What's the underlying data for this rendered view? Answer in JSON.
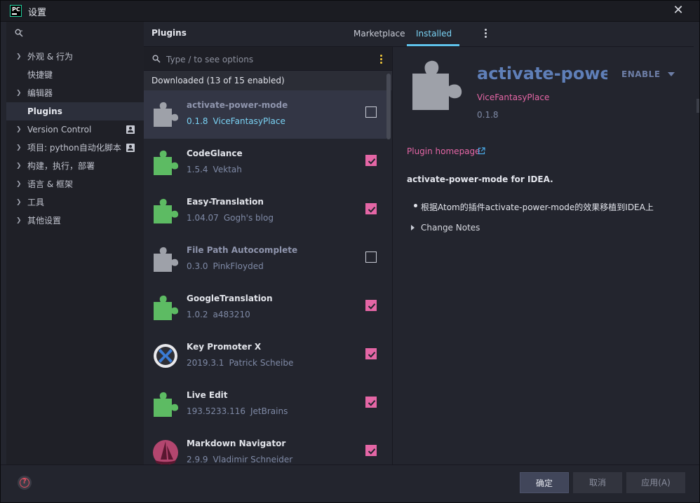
{
  "window": {
    "title": "设置",
    "app_logo": "PC"
  },
  "sidebar": {
    "items": [
      {
        "label": "外观 & 行为",
        "expandable": true
      },
      {
        "label": "快捷键",
        "expandable": false
      },
      {
        "label": "编辑器",
        "expandable": true
      },
      {
        "label": "Plugins",
        "expandable": false,
        "active": true
      },
      {
        "label": "Version Control",
        "expandable": true,
        "badge": "person-icon"
      },
      {
        "label": "项目: python自动化脚本",
        "expandable": true,
        "badge": "person-icon"
      },
      {
        "label": "构建，执行，部署",
        "expandable": true
      },
      {
        "label": "语言 & 框架",
        "expandable": true
      },
      {
        "label": "工具",
        "expandable": true
      },
      {
        "label": "其他设置",
        "expandable": true
      }
    ]
  },
  "header": {
    "title": "Plugins",
    "tabs": [
      {
        "label": "Marketplace"
      },
      {
        "label": "Installed",
        "selected": true
      }
    ]
  },
  "list": {
    "search_placeholder": "Type / to see options",
    "group_label": "Downloaded (13 of 15 enabled)",
    "plugins": [
      {
        "name": "activate-power-mode",
        "version": "0.1.8",
        "vendor": "ViceFantasyPlace",
        "enabled": false,
        "icon": "puzzle-gray-icon",
        "selected": true
      },
      {
        "name": "CodeGlance",
        "version": "1.5.4",
        "vendor": "Vektah",
        "enabled": true,
        "icon": "puzzle-green-icon"
      },
      {
        "name": "Easy-Translation",
        "version": "1.04.07",
        "vendor": "Gogh's blog",
        "enabled": true,
        "icon": "puzzle-green-icon"
      },
      {
        "name": "File Path Autocomplete",
        "version": "0.3.0",
        "vendor": "PinkFloyded",
        "enabled": false,
        "icon": "puzzle-gray-icon"
      },
      {
        "name": "GoogleTranslation",
        "version": "1.0.2",
        "vendor": "a483210",
        "enabled": true,
        "icon": "puzzle-green-icon"
      },
      {
        "name": "Key Promoter X",
        "version": "2019.3.1",
        "vendor": "Patrick Scheibe",
        "enabled": true,
        "icon": "key-promoter-icon"
      },
      {
        "name": "Live Edit",
        "version": "193.5233.116",
        "vendor": "JetBrains",
        "enabled": true,
        "icon": "puzzle-green-icon"
      },
      {
        "name": "Markdown Navigator",
        "version": "2.9.9",
        "vendor": "Vladimir Schneider",
        "enabled": true,
        "icon": "markdown-navigator-icon"
      }
    ]
  },
  "detail": {
    "name": "activate-power-mode",
    "enable_label": "ENABLE",
    "vendor": "ViceFantasyPlace",
    "version": "0.1.8",
    "homepage_label": "Plugin homepage",
    "description_title": "activate-power-mode for IDEA.",
    "bullet": "根据Atom的插件activate-power-mode的效果移植到IDEA上",
    "change_notes_label": "Change Notes"
  },
  "footer": {
    "ok_label": "确定",
    "cancel_label": "取消",
    "apply_label": "应用(A)"
  },
  "colors": {
    "accent_pink": "#e466a5",
    "accent_blue": "#7ad3f5",
    "puzzle_green": "#5dbb63",
    "puzzle_gray": "#9ea1a9"
  }
}
